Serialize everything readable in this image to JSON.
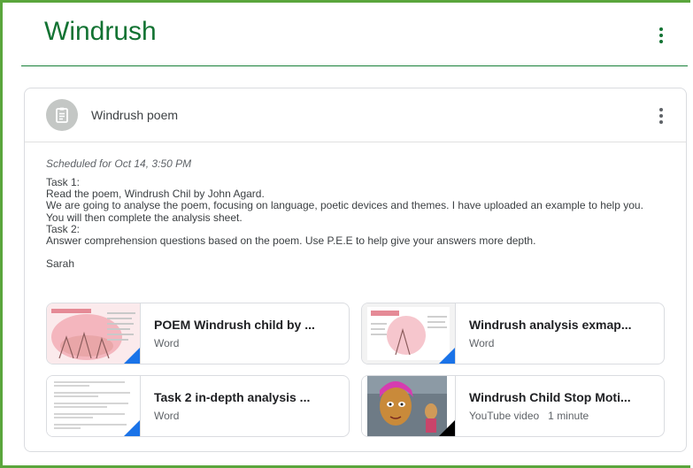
{
  "topic": {
    "title": "Windrush",
    "menu_icon": "more-vert-icon"
  },
  "card": {
    "icon": "assignment-icon",
    "title": "Windrush poem",
    "menu_icon": "more-vert-icon",
    "scheduled": "Scheduled for Oct 14, 3:50 PM",
    "description": [
      "Task 1:",
      "Read the poem, Windrush Chil by John Agard.",
      "We are going to analyse the poem, focusing on language, poetic devices and themes. I have uploaded an example to help you.",
      "You will then complete the analysis sheet.",
      "Task 2:",
      "Answer comprehension questions based on the poem. Use P.E.E to help give your answers more depth.",
      "",
      "Sarah"
    ]
  },
  "attachments": [
    {
      "title": "POEM Windrush child by ...",
      "type": "Word",
      "corner_color": "#1a73e8"
    },
    {
      "title": "Windrush analysis exmap...",
      "type": "Word",
      "corner_color": "#1a73e8"
    },
    {
      "title": "Task 2 in-depth analysis ...",
      "type": "Word",
      "corner_color": "#1a73e8"
    },
    {
      "title": "Windrush Child Stop Moti...",
      "type": "YouTube video   1 minute",
      "corner_color": "#000000"
    }
  ],
  "colors": {
    "frame_green": "#5aa63c",
    "topic_green": "#137333",
    "word_blue": "#1a73e8"
  }
}
